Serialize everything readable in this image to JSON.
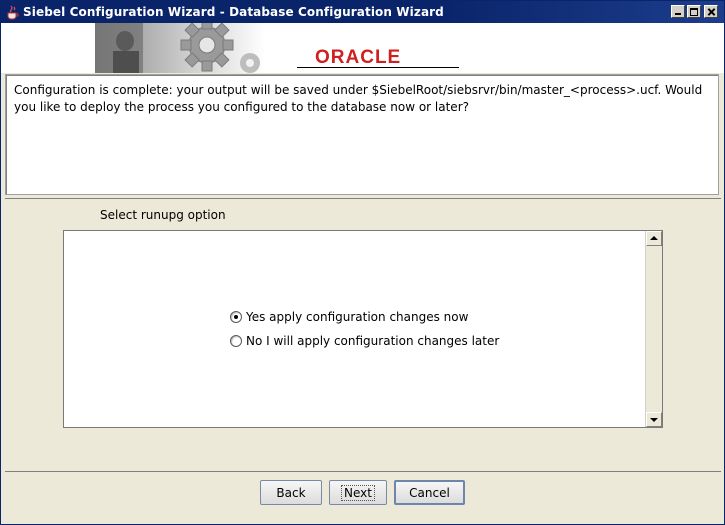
{
  "window": {
    "title": "Siebel Configuration Wizard - Database Configuration Wizard",
    "controls": [
      "minimize-icon",
      "maximize-icon",
      "close-icon"
    ]
  },
  "banner": {
    "logo_text": "ORACLE",
    "logo_color": "#d01f1f",
    "art_icon": "gear-icon"
  },
  "message": {
    "text": "Configuration is complete: your output will be saved under $SiebelRoot/siebsrvr/bin/master_<process>.ucf. Would you like to deploy the process you configured to the database now or later?"
  },
  "runupg": {
    "label": "Select runupg option",
    "options": [
      {
        "label": "Yes apply configuration changes now",
        "selected": true
      },
      {
        "label": "No I will apply configuration changes later",
        "selected": false
      }
    ]
  },
  "buttons": {
    "back": "Back",
    "next": "Next",
    "cancel": "Cancel"
  },
  "colors": {
    "titlebar": "#0a246a",
    "window_bg": "#ece9d8"
  }
}
